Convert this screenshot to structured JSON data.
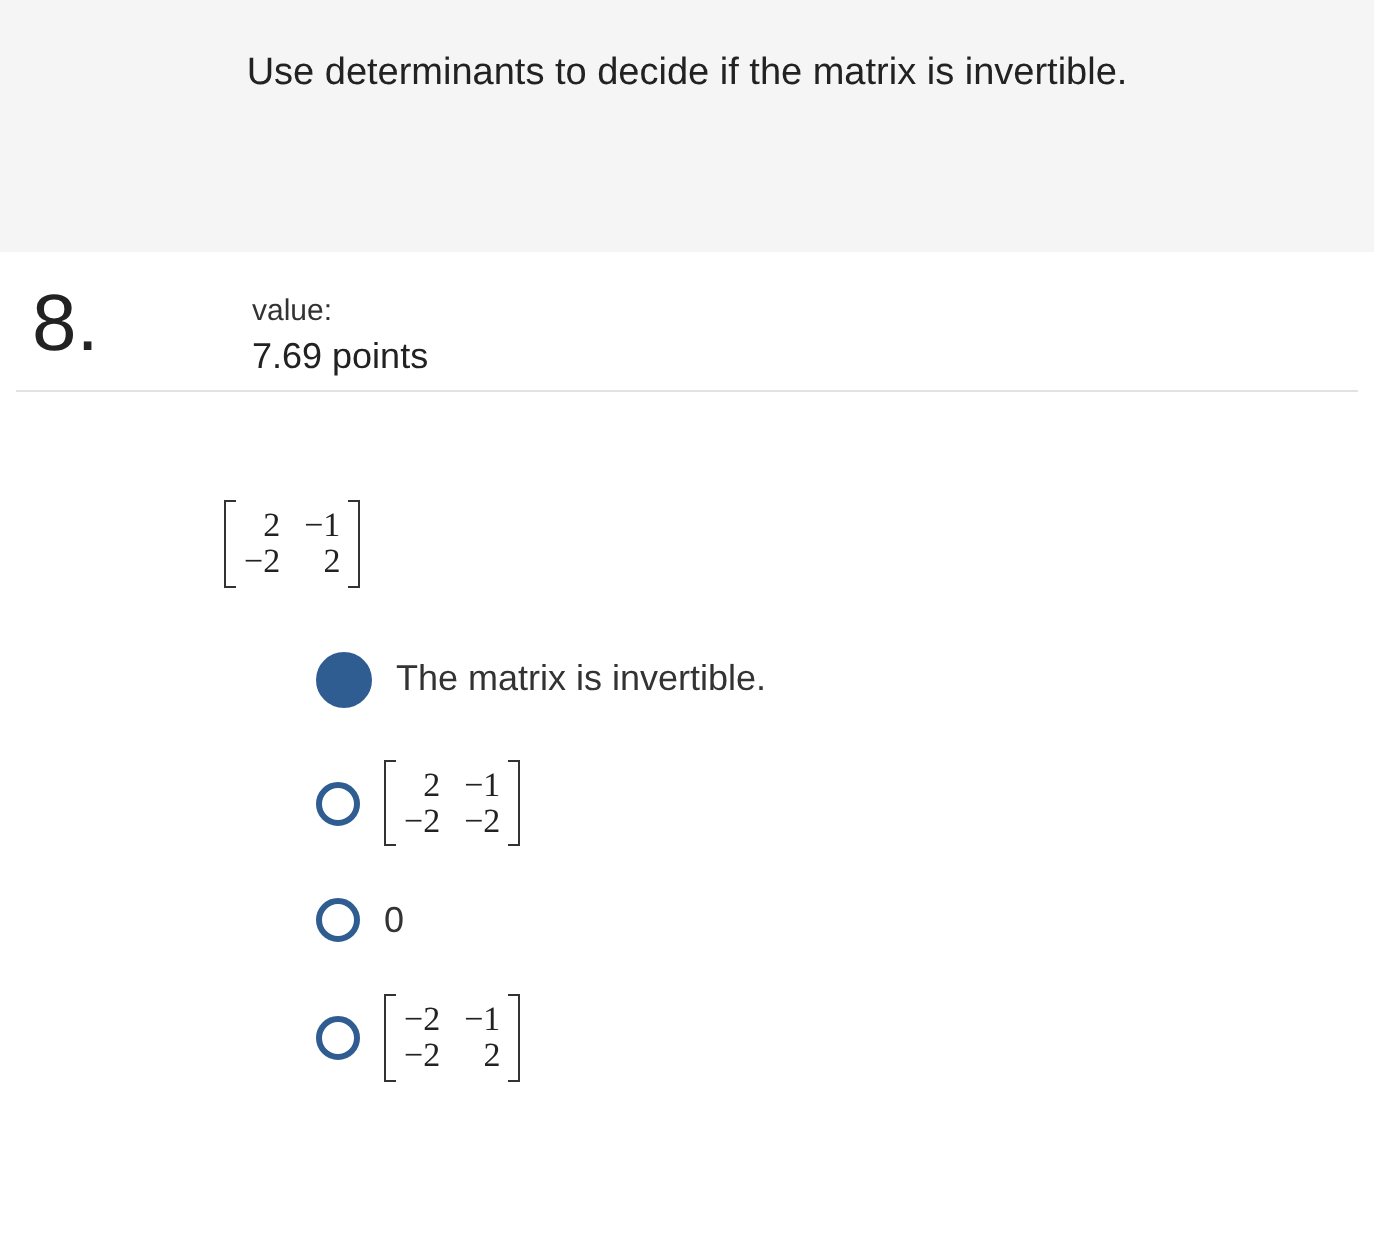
{
  "instruction": "Use determinants to decide if the matrix is invertible.",
  "question": {
    "number": "8.",
    "value_label": "value:",
    "points": "7.69 points"
  },
  "matrix": [
    [
      "2",
      "−1"
    ],
    [
      "−2",
      "2"
    ]
  ],
  "options": [
    {
      "kind": "text",
      "selected": true,
      "text": "The matrix is invertible."
    },
    {
      "kind": "matrix",
      "selected": false,
      "rows": [
        [
          "2",
          "−1"
        ],
        [
          "−2",
          "−2"
        ]
      ]
    },
    {
      "kind": "text",
      "selected": false,
      "text": "0"
    },
    {
      "kind": "matrix",
      "selected": false,
      "rows": [
        [
          "−2",
          "−1"
        ],
        [
          "−2",
          "2"
        ]
      ]
    }
  ]
}
